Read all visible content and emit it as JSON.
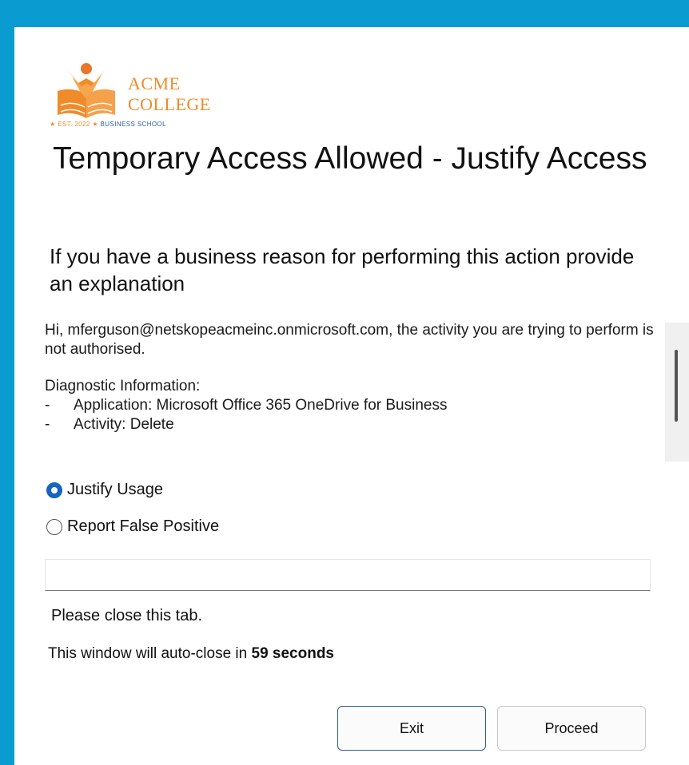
{
  "logo": {
    "name_line1": "ACME",
    "name_line2": "COLLEGE",
    "tagline_est": "EST. 2022",
    "tagline_school": "BUSINESS SCHOOL",
    "brand_color": "#f08b2a"
  },
  "title": "Temporary Access Allowed - Justify Access",
  "subtitle": "If you have a business reason for performing this action provide an explanation",
  "info": {
    "greeting": "Hi, mferguson@netskopeacmeinc.onmicrosoft.com, the activity you are trying to perform is not authorised.",
    "diagnostic_header": "Diagnostic Information:",
    "items": [
      {
        "dash": "-",
        "text": "Application: Microsoft Office 365 OneDrive for Business"
      },
      {
        "dash": "-",
        "text": "Activity: Delete"
      }
    ]
  },
  "options": [
    {
      "label": "Justify Usage",
      "selected": true
    },
    {
      "label": "Report False Positive",
      "selected": false
    }
  ],
  "justification_input": {
    "value": "",
    "placeholder": ""
  },
  "close_message": "Please close this tab.",
  "autoclose": {
    "prefix": "This window will auto-close in",
    "countdown": "59 seconds"
  },
  "buttons": {
    "exit": "Exit",
    "proceed": "Proceed"
  },
  "colors": {
    "background": "#0a9bd0",
    "radio_accent": "#1565c0"
  }
}
